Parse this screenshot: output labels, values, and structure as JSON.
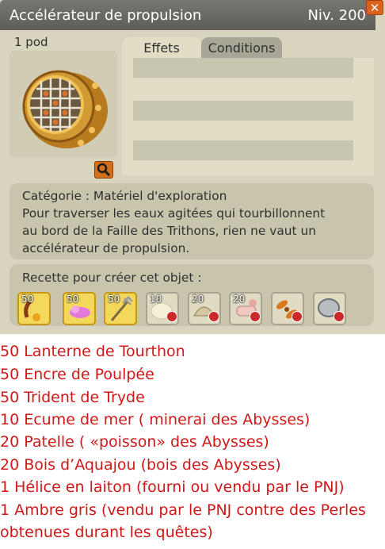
{
  "header": {
    "title": "Accélérateur de propulsion",
    "level": "Niv. 200",
    "close_symbol": "✕"
  },
  "item": {
    "weight": "1 pod",
    "icon": "propulsion-accelerator-icon"
  },
  "tabs": [
    {
      "label": "Effets"
    },
    {
      "label": "Conditions"
    }
  ],
  "description": {
    "lines": [
      "Catégorie : Matériel d'exploration",
      "Pour traverser les eaux agitées qui tourbillonnent",
      "au bord de la Faille des Trithons, rien ne vaut un",
      "accélérateur de propulsion."
    ]
  },
  "recipe": {
    "title": "Recette pour créer cet objet :",
    "ingredients": [
      {
        "qty": "50",
        "icon": "lantern-icon",
        "owned": true
      },
      {
        "qty": "50",
        "icon": "ink-icon",
        "owned": true
      },
      {
        "qty": "50",
        "icon": "trident-icon",
        "owned": true
      },
      {
        "qty": "10",
        "icon": "sea-foam-icon",
        "owned": false
      },
      {
        "qty": "20",
        "icon": "limpet-icon",
        "owned": false
      },
      {
        "qty": "20",
        "icon": "wood-icon",
        "owned": false
      },
      {
        "qty": "",
        "icon": "propeller-icon",
        "owned": false
      },
      {
        "qty": "",
        "icon": "ambergris-icon",
        "owned": false
      }
    ]
  },
  "notes": [
    "50 Lanterne de Tourthon",
    "50 Encre de Poulpée",
    "50 Trident de Tryde",
    "10 Ecume de mer ( minerai des Abysses)",
    "20 Patelle ( «poisson» des Abysses)",
    "20 Bois d’Aquajou (bois des Abysses)",
    "1 Hélice en laiton (fourni ou vendu par le PNJ)",
    "1 Ambre gris (vendu par le PNJ contre des Perles",
    "obtenues durant les quêtes)"
  ],
  "colors": {
    "panel": "#d8d4bd",
    "titlebar": "#6b6964",
    "note_text": "#d11818",
    "owned_slot": "#f3d85b"
  }
}
